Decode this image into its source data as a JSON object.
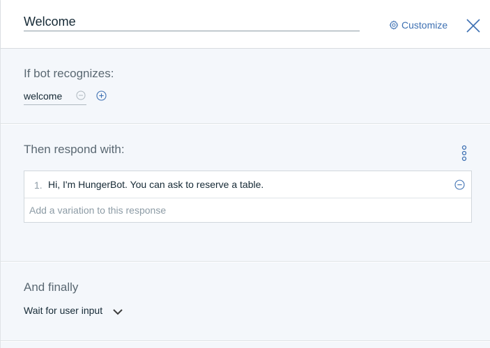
{
  "header": {
    "title_value": "Welcome",
    "customize_label": "Customize"
  },
  "recognize": {
    "label": "If bot recognizes:",
    "condition": "welcome"
  },
  "respond": {
    "label": "Then respond with:",
    "responses": [
      {
        "number": "1.",
        "text": "Hi, I'm HungerBot. You can ask to reserve a table."
      }
    ],
    "variation_placeholder": "Add a variation to this response"
  },
  "finally": {
    "label": "And finally",
    "selected": "Wait for user input"
  },
  "colors": {
    "accent": "#3d70b2",
    "section_bg": "#f4f7fb",
    "muted_text": "#5a6872"
  }
}
